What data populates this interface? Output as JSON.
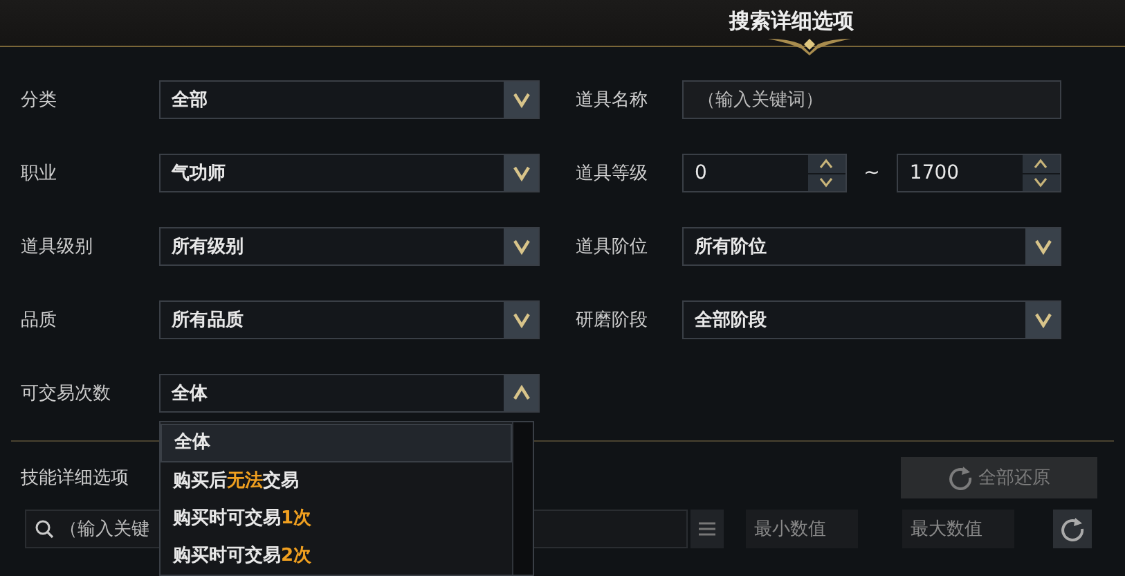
{
  "title": "搜索详细选项",
  "filters_left": [
    {
      "label": "分类",
      "value": "全部",
      "open": false
    },
    {
      "label": "职业",
      "value": "气功师",
      "open": false
    },
    {
      "label": "道具级别",
      "value": "所有级别",
      "open": false
    },
    {
      "label": "品质",
      "value": "所有品质",
      "open": false
    },
    {
      "label": "可交易次数",
      "value": "全体",
      "open": true
    }
  ],
  "filters_right": [
    {
      "kind": "text",
      "label": "道具名称",
      "placeholder": "（输入关键词）"
    },
    {
      "kind": "range",
      "label": "道具等级",
      "min": "0",
      "separator": "~",
      "max": "1700"
    },
    {
      "kind": "select",
      "label": "道具阶位",
      "value": "所有阶位"
    },
    {
      "kind": "select",
      "label": "研磨阶段",
      "value": "全部阶段"
    }
  ],
  "dropdown": {
    "options": [
      {
        "selected": true,
        "parts": [
          {
            "text": "全体",
            "highlight": false
          }
        ]
      },
      {
        "selected": false,
        "parts": [
          {
            "text": "购买后",
            "highlight": false
          },
          {
            "text": "无法",
            "highlight": true
          },
          {
            "text": "交易",
            "highlight": false
          }
        ]
      },
      {
        "selected": false,
        "parts": [
          {
            "text": "购买时可交易",
            "highlight": false
          },
          {
            "text": "1次",
            "highlight": true
          }
        ]
      },
      {
        "selected": false,
        "parts": [
          {
            "text": "购买时可交易",
            "highlight": false
          },
          {
            "text": "2次",
            "highlight": true
          }
        ]
      }
    ]
  },
  "skill_section": {
    "label": "技能详细选项",
    "reset_button": {
      "label": "全部还原",
      "disabled": true
    },
    "search": {
      "placeholder": "（输入关键"
    },
    "min": {
      "placeholder": "最小数值"
    },
    "max": {
      "placeholder": "最大数值"
    }
  }
}
